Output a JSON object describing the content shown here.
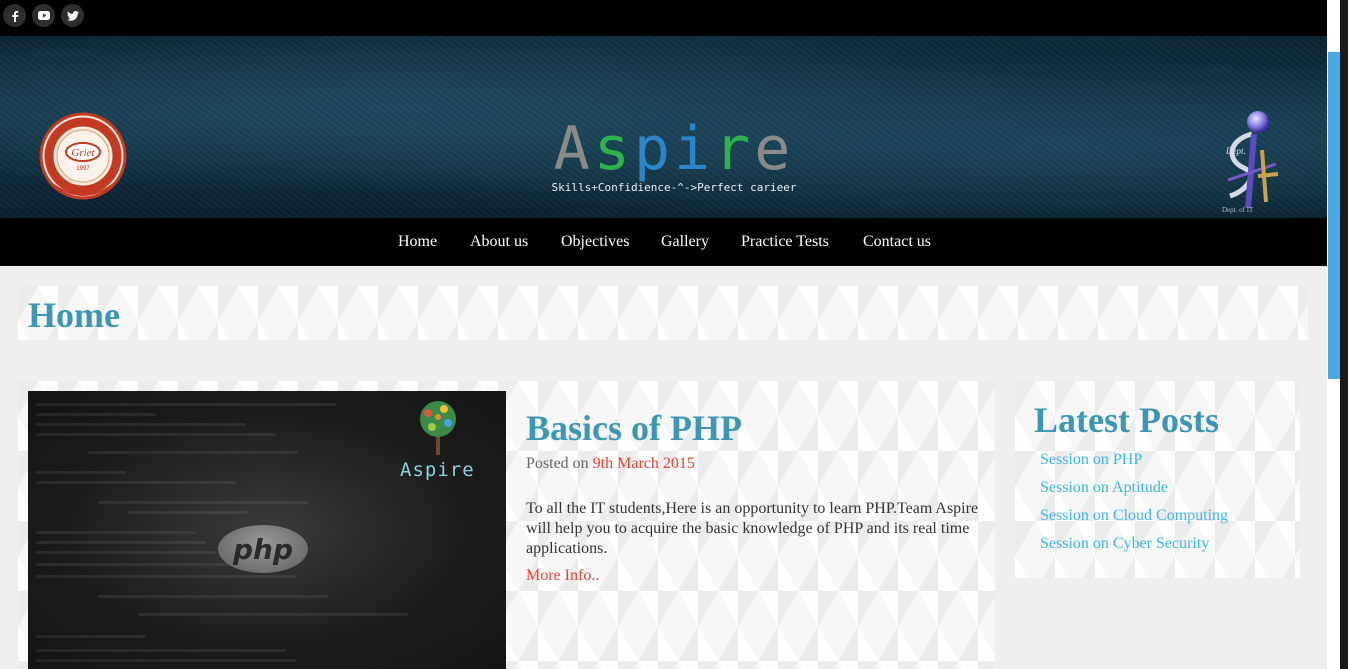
{
  "social": [
    {
      "icon": "facebook-icon"
    },
    {
      "icon": "youtube-icon"
    },
    {
      "icon": "twitter-icon"
    }
  ],
  "header": {
    "title_letters": [
      "A",
      "s",
      "p",
      "i",
      "r",
      "e"
    ],
    "title_colors": [
      "#8a8a8a",
      "#2db34a",
      "#2a86c8",
      "#2a86c8",
      "#2db34a",
      "#8a8a8a"
    ],
    "tagline": "Skills+Confidience-^->Perfect carieer",
    "left_logo_text": "Griet",
    "left_logo_year": "1997",
    "left_logo_ring_text": "Gokaraju Rangaraju Institute of Engineering & Technology",
    "right_logo_text": "Dept. of IT"
  },
  "nav": {
    "items": [
      "Home",
      "About us",
      "Objectives",
      "Gallery",
      "Practice Tests",
      "Contact us"
    ]
  },
  "page": {
    "title": "Home"
  },
  "post": {
    "image_brand": "Aspire",
    "image_badge": "php",
    "title": "Basics of PHP",
    "posted_on_label": "Posted on",
    "date": "9th March 2015",
    "body": "To all the IT students,Here is an opportunity to learn PHP.Team Aspire will help you to acquire the basic knowledge of PHP and its real time applications.",
    "more_label": "More Info.."
  },
  "sidebar": {
    "title": "Latest Posts",
    "links": [
      "Session on PHP",
      "Session on Aptitude",
      "Session on Cloud Computing",
      "Session on Cyber Security"
    ]
  },
  "colors": {
    "accent": "#3b97b4",
    "link": "#3cb6e4",
    "highlight": "#e8442c",
    "scroll_thumb": "#4da9e4"
  }
}
